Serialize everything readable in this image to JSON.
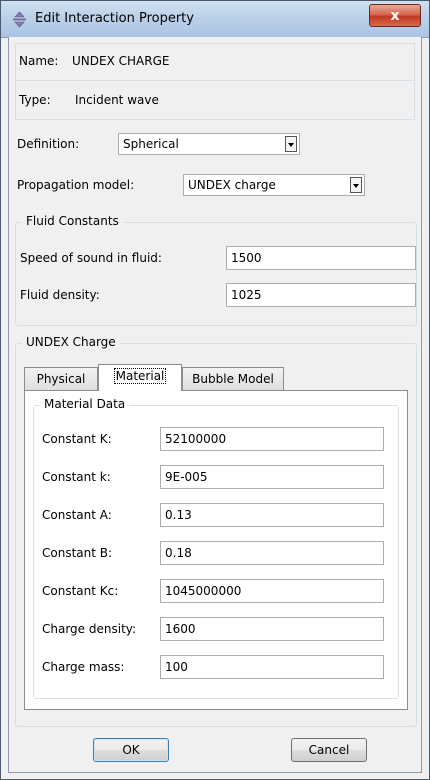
{
  "window": {
    "title": "Edit Interaction Property",
    "close_symbol": "x",
    "icon": "move-arrows-icon"
  },
  "header": {
    "name_label": "Name:",
    "name_value": "UNDEX CHARGE",
    "type_label": "Type:",
    "type_value": "Incident wave"
  },
  "definition": {
    "label": "Definition:",
    "value": "Spherical"
  },
  "propagation": {
    "label": "Propagation model:",
    "value": "UNDEX charge"
  },
  "fluid": {
    "group_title": "Fluid Constants",
    "speed_label": "Speed of sound in fluid:",
    "speed_value": "1500",
    "density_label": "Fluid density:",
    "density_value": "1025"
  },
  "undex": {
    "group_title": "UNDEX Charge",
    "tabs": [
      {
        "label": "Physical"
      },
      {
        "label": "Material"
      },
      {
        "label": "Bubble Model"
      }
    ],
    "active_tab": "Material",
    "material_group_title": "Material Data",
    "rows": [
      {
        "label": "Constant K:",
        "value": "52100000"
      },
      {
        "label": "Constant k:",
        "value": "9E-005"
      },
      {
        "label": "Constant A:",
        "value": "0.13"
      },
      {
        "label": "Constant B:",
        "value": "0.18"
      },
      {
        "label": "Constant Kc:",
        "value": "1045000000"
      },
      {
        "label": "Charge density:",
        "value": "1600"
      },
      {
        "label": "Charge mass:",
        "value": "100"
      }
    ]
  },
  "buttons": {
    "ok_label": "OK",
    "cancel_label": "Cancel"
  }
}
